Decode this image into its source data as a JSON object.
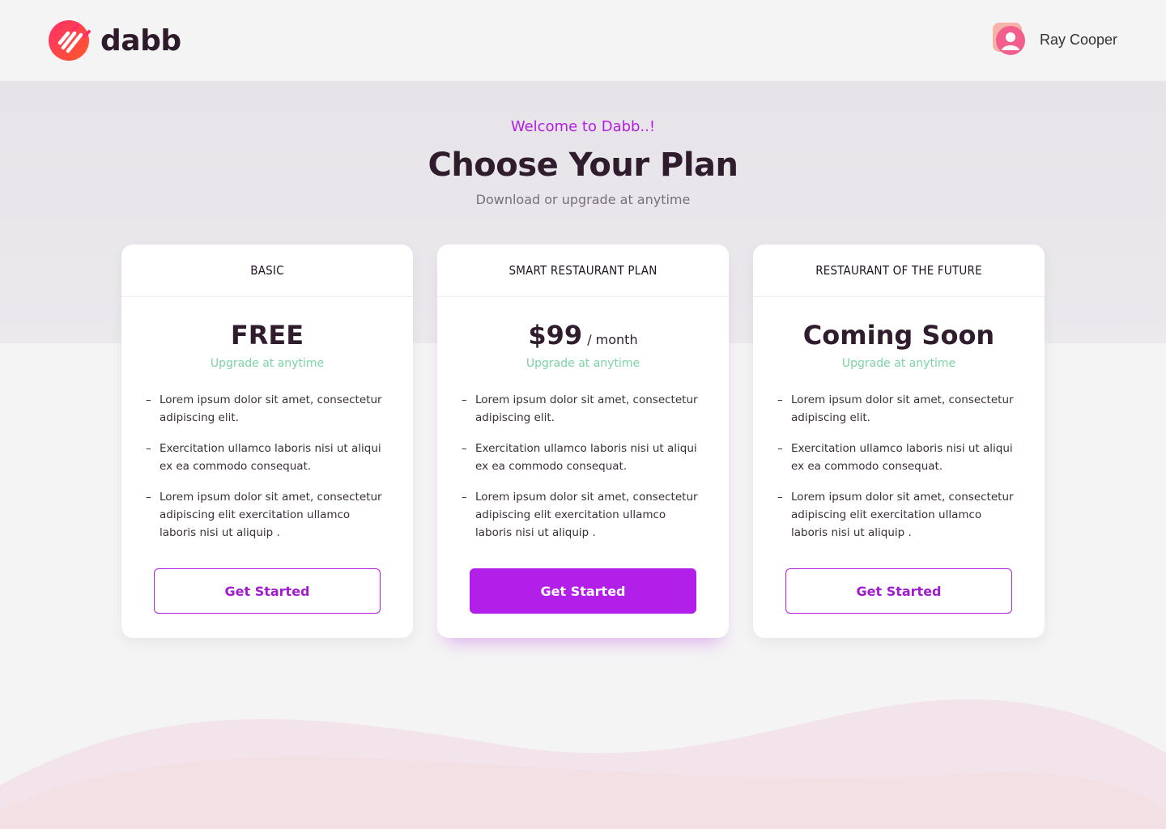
{
  "brand": {
    "name": "dabb",
    "accent": "#b21fe0",
    "logo_gradient": [
      "#ff2e6a",
      "#ff5a2a"
    ]
  },
  "user": {
    "name": "Ray Cooper"
  },
  "hero": {
    "welcome": "Welcome to Dabb..!",
    "title": "Choose Your Plan",
    "subtitle": "Download or upgrade at anytime"
  },
  "plans": [
    {
      "name": "BASIC",
      "price": "FREE",
      "price_unit": "",
      "note": "Upgrade at anytime",
      "features": [
        "Lorem ipsum dolor sit amet, consectetur adipiscing elit.",
        "Exercitation ullamco laboris nisi ut aliqui ex ea commodo consequat.",
        "Lorem ipsum dolor sit amet, consectetur adipiscing elit exercitation ullamco laboris nisi ut aliquip ."
      ],
      "cta": "Get Started",
      "cta_style": "outline"
    },
    {
      "name": "SMART RESTAURANT PLAN",
      "price": "$99",
      "price_unit": "/ month",
      "note": "Upgrade at anytime",
      "features": [
        "Lorem ipsum dolor sit amet, consectetur adipiscing elit.",
        "Exercitation ullamco laboris nisi ut aliqui ex ea commodo consequat.",
        "Lorem ipsum dolor sit amet, consectetur adipiscing elit exercitation ullamco laboris nisi ut aliquip ."
      ],
      "cta": "Get Started",
      "cta_style": "filled"
    },
    {
      "name": "RESTAURANT OF THE FUTURE",
      "price": "Coming Soon",
      "price_unit": "",
      "note": "Upgrade at anytime",
      "features": [
        "Lorem ipsum dolor sit amet, consectetur adipiscing elit.",
        "Exercitation ullamco laboris nisi ut aliqui ex ea commodo consequat.",
        "Lorem ipsum dolor sit amet, consectetur adipiscing elit exercitation ullamco laboris nisi ut aliquip ."
      ],
      "cta": "Get Started",
      "cta_style": "outline"
    }
  ],
  "icons": {
    "logo": "dabb-logo-icon",
    "avatar": "user-avatar-icon",
    "bullet": "dash"
  }
}
